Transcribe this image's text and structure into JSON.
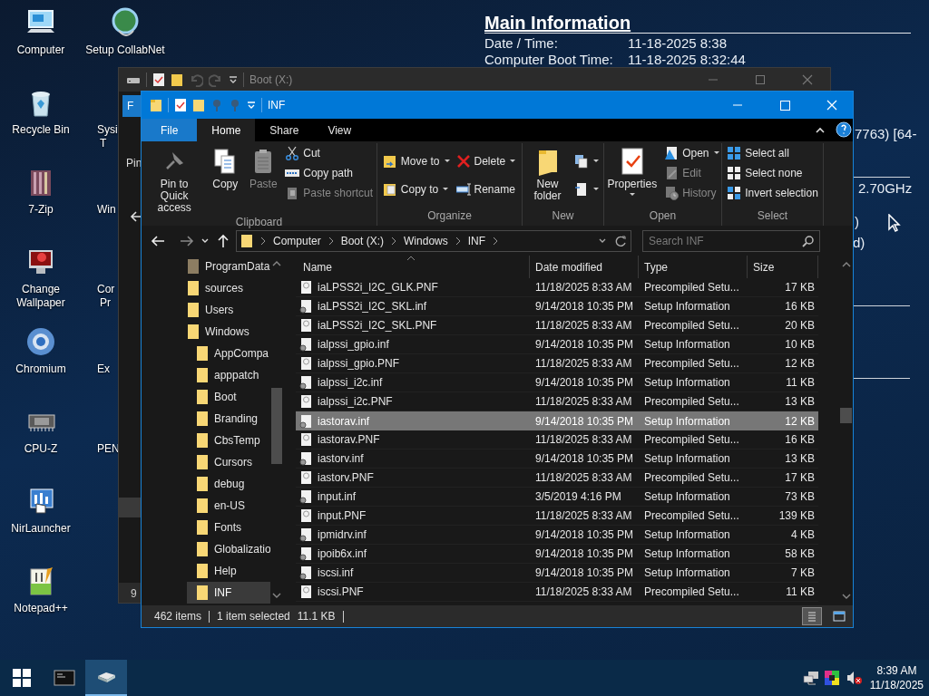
{
  "desktop": {
    "icons": [
      {
        "label": "Computer"
      },
      {
        "label": "Recycle Bin"
      },
      {
        "label": "7-Zip"
      },
      {
        "label": "Change Wallpaper"
      },
      {
        "label": "Chromium"
      },
      {
        "label": "CPU-Z"
      },
      {
        "label": "NirLauncher"
      },
      {
        "label": "Notepad++"
      }
    ],
    "icons_column_2": [
      {
        "lines": [
          "Setup CollabNet"
        ]
      },
      {
        "lines": [
          "Sysi",
          "T"
        ]
      },
      {
        "lines": [
          "Win"
        ]
      },
      {
        "lines": [
          "Cor",
          "Pr"
        ]
      },
      {
        "lines": [
          "Ex"
        ]
      },
      {
        "lines": [
          "PEN"
        ]
      }
    ]
  },
  "info_panel": {
    "title": "Main Information",
    "rows": [
      {
        "label": "Date / Time:",
        "value": "11-18-2025 8:38"
      },
      {
        "label": "Computer Boot Time:",
        "value": "11-18-2025 8:32:44"
      }
    ],
    "fragments": [
      "7763) [64-",
      "2.70GHz",
      ")",
      "d)"
    ]
  },
  "back_window": {
    "title": "Boot (X:)",
    "file_tab": "F",
    "pin_label": "Pin",
    "status": "9"
  },
  "explorer": {
    "title": "INF",
    "ribbon_tabs": [
      {
        "label": "File",
        "kind": "file",
        "selected": false
      },
      {
        "label": "Home",
        "kind": "tab",
        "selected": true
      },
      {
        "label": "Share",
        "kind": "tab",
        "selected": false
      },
      {
        "label": "View",
        "kind": "tab",
        "selected": false
      }
    ],
    "ribbon_groups": [
      {
        "label": "Clipboard",
        "columns": [
          [
            {
              "label": "Pin to Quick access",
              "kind": "large",
              "dropdown": false,
              "disabled": false
            }
          ],
          [
            {
              "label": "Copy",
              "kind": "large",
              "dropdown": false,
              "disabled": false
            }
          ],
          [
            {
              "label": "Paste",
              "kind": "large",
              "dropdown": false,
              "disabled": true
            }
          ],
          [
            {
              "label": "Cut",
              "kind": "small",
              "dropdown": false,
              "disabled": false
            },
            {
              "label": "Copy path",
              "kind": "small",
              "dropdown": false,
              "disabled": false
            },
            {
              "label": "Paste shortcut",
              "kind": "small",
              "dropdown": false,
              "disabled": true
            }
          ]
        ]
      },
      {
        "label": "Organize",
        "columns": [
          [
            {
              "label": "Move to",
              "kind": "small",
              "dropdown": true,
              "disabled": false
            },
            {
              "label": "Copy to",
              "kind": "small",
              "dropdown": true,
              "disabled": false
            }
          ],
          [
            {
              "label": "Delete",
              "kind": "small",
              "dropdown": true,
              "disabled": false
            },
            {
              "label": "Rename",
              "kind": "small",
              "dropdown": false,
              "disabled": false
            }
          ]
        ]
      },
      {
        "label": "New",
        "columns": [
          [
            {
              "label": "New folder",
              "kind": "large",
              "dropdown": false,
              "disabled": false
            }
          ],
          [
            {
              "kind": "small",
              "dropdown": true,
              "disabled": false
            },
            {
              "kind": "small",
              "dropdown": true,
              "disabled": false
            }
          ]
        ]
      },
      {
        "label": "Open",
        "columns": [
          [
            {
              "label": "Properties",
              "kind": "large",
              "dropdown": true,
              "disabled": false
            }
          ],
          [
            {
              "label": "Open",
              "kind": "small",
              "dropdown": true,
              "disabled": false
            },
            {
              "label": "Edit",
              "kind": "small",
              "dropdown": false,
              "disabled": true
            },
            {
              "label": "History",
              "kind": "small",
              "dropdown": false,
              "disabled": true
            }
          ]
        ]
      },
      {
        "label": "Select",
        "columns": [
          [
            {
              "label": "Select all",
              "kind": "small",
              "dropdown": false,
              "disabled": false
            },
            {
              "label": "Select none",
              "kind": "small",
              "dropdown": false,
              "disabled": false
            },
            {
              "label": "Invert selection",
              "kind": "small",
              "dropdown": false,
              "disabled": false
            }
          ]
        ]
      }
    ],
    "breadcrumb": [
      "Computer",
      "Boot (X:)",
      "Windows",
      "INF"
    ],
    "search": {
      "placeholder": "Search INF"
    },
    "nav_tree": [
      {
        "label": "ProgramData",
        "hidden": true,
        "selected": false
      },
      {
        "label": "sources",
        "hidden": false,
        "selected": false
      },
      {
        "label": "Users",
        "hidden": false,
        "selected": false
      },
      {
        "label": "Windows",
        "hidden": false,
        "selected": false,
        "children": [
          {
            "label": "AppCompa",
            "hidden": false,
            "selected": false
          },
          {
            "label": "apppatch",
            "hidden": false,
            "selected": false
          },
          {
            "label": "Boot",
            "hidden": false,
            "selected": false
          },
          {
            "label": "Branding",
            "hidden": false,
            "selected": false
          },
          {
            "label": "CbsTemp",
            "hidden": false,
            "selected": false
          },
          {
            "label": "Cursors",
            "hidden": false,
            "selected": false
          },
          {
            "label": "debug",
            "hidden": false,
            "selected": false
          },
          {
            "label": "en-US",
            "hidden": false,
            "selected": false
          },
          {
            "label": "Fonts",
            "hidden": false,
            "selected": false
          },
          {
            "label": "Globalizatio",
            "hidden": false,
            "selected": false
          },
          {
            "label": "Help",
            "hidden": false,
            "selected": false
          },
          {
            "label": "INF",
            "hidden": false,
            "selected": true
          }
        ]
      }
    ],
    "columns": [
      "Name",
      "Date modified",
      "Type",
      "Size"
    ],
    "rows": [
      {
        "name": "iaLPSS2i_I2C_GLK.PNF",
        "date": "11/18/2025 8:33 AM",
        "type": "Precompiled Setu...",
        "size": "17 KB",
        "kind": "pnf",
        "selected": false
      },
      {
        "name": "iaLPSS2i_I2C_SKL.inf",
        "date": "9/14/2018 10:35 PM",
        "type": "Setup Information",
        "size": "16 KB",
        "kind": "inf",
        "selected": false
      },
      {
        "name": "iaLPSS2i_I2C_SKL.PNF",
        "date": "11/18/2025 8:33 AM",
        "type": "Precompiled Setu...",
        "size": "20 KB",
        "kind": "pnf",
        "selected": false
      },
      {
        "name": "ialpssi_gpio.inf",
        "date": "9/14/2018 10:35 PM",
        "type": "Setup Information",
        "size": "10 KB",
        "kind": "inf",
        "selected": false
      },
      {
        "name": "ialpssi_gpio.PNF",
        "date": "11/18/2025 8:33 AM",
        "type": "Precompiled Setu...",
        "size": "12 KB",
        "kind": "pnf",
        "selected": false
      },
      {
        "name": "ialpssi_i2c.inf",
        "date": "9/14/2018 10:35 PM",
        "type": "Setup Information",
        "size": "11 KB",
        "kind": "inf",
        "selected": false
      },
      {
        "name": "ialpssi_i2c.PNF",
        "date": "11/18/2025 8:33 AM",
        "type": "Precompiled Setu...",
        "size": "13 KB",
        "kind": "pnf",
        "selected": false
      },
      {
        "name": "iastorav.inf",
        "date": "9/14/2018 10:35 PM",
        "type": "Setup Information",
        "size": "12 KB",
        "kind": "inf",
        "selected": true
      },
      {
        "name": "iastorav.PNF",
        "date": "11/18/2025 8:33 AM",
        "type": "Precompiled Setu...",
        "size": "16 KB",
        "kind": "pnf",
        "selected": false
      },
      {
        "name": "iastorv.inf",
        "date": "9/14/2018 10:35 PM",
        "type": "Setup Information",
        "size": "13 KB",
        "kind": "inf",
        "selected": false
      },
      {
        "name": "iastorv.PNF",
        "date": "11/18/2025 8:33 AM",
        "type": "Precompiled Setu...",
        "size": "17 KB",
        "kind": "pnf",
        "selected": false
      },
      {
        "name": "input.inf",
        "date": "3/5/2019 4:16 PM",
        "type": "Setup Information",
        "size": "73 KB",
        "kind": "inf",
        "selected": false
      },
      {
        "name": "input.PNF",
        "date": "11/18/2025 8:33 AM",
        "type": "Precompiled Setu...",
        "size": "139 KB",
        "kind": "pnf",
        "selected": false
      },
      {
        "name": "ipmidrv.inf",
        "date": "9/14/2018 10:35 PM",
        "type": "Setup Information",
        "size": "4 KB",
        "kind": "inf",
        "selected": false
      },
      {
        "name": "ipoib6x.inf",
        "date": "9/14/2018 10:35 PM",
        "type": "Setup Information",
        "size": "58 KB",
        "kind": "inf",
        "selected": false
      },
      {
        "name": "iscsi.inf",
        "date": "9/14/2018 10:35 PM",
        "type": "Setup Information",
        "size": "7 KB",
        "kind": "inf",
        "selected": false
      },
      {
        "name": "iscsi.PNF",
        "date": "11/18/2025 8:33 AM",
        "type": "Precompiled Setu...",
        "size": "11 KB",
        "kind": "pnf",
        "selected": false
      }
    ],
    "status": {
      "items": "462 items",
      "selection": "1 item selected",
      "size": "11.1 KB"
    },
    "views": [
      {
        "selected": true
      },
      {
        "selected": false
      }
    ]
  },
  "taskbar": {
    "apps": [
      {
        "selected": false
      },
      {
        "selected": true
      }
    ],
    "time": "8:39 AM",
    "date": "11/18/2025"
  }
}
